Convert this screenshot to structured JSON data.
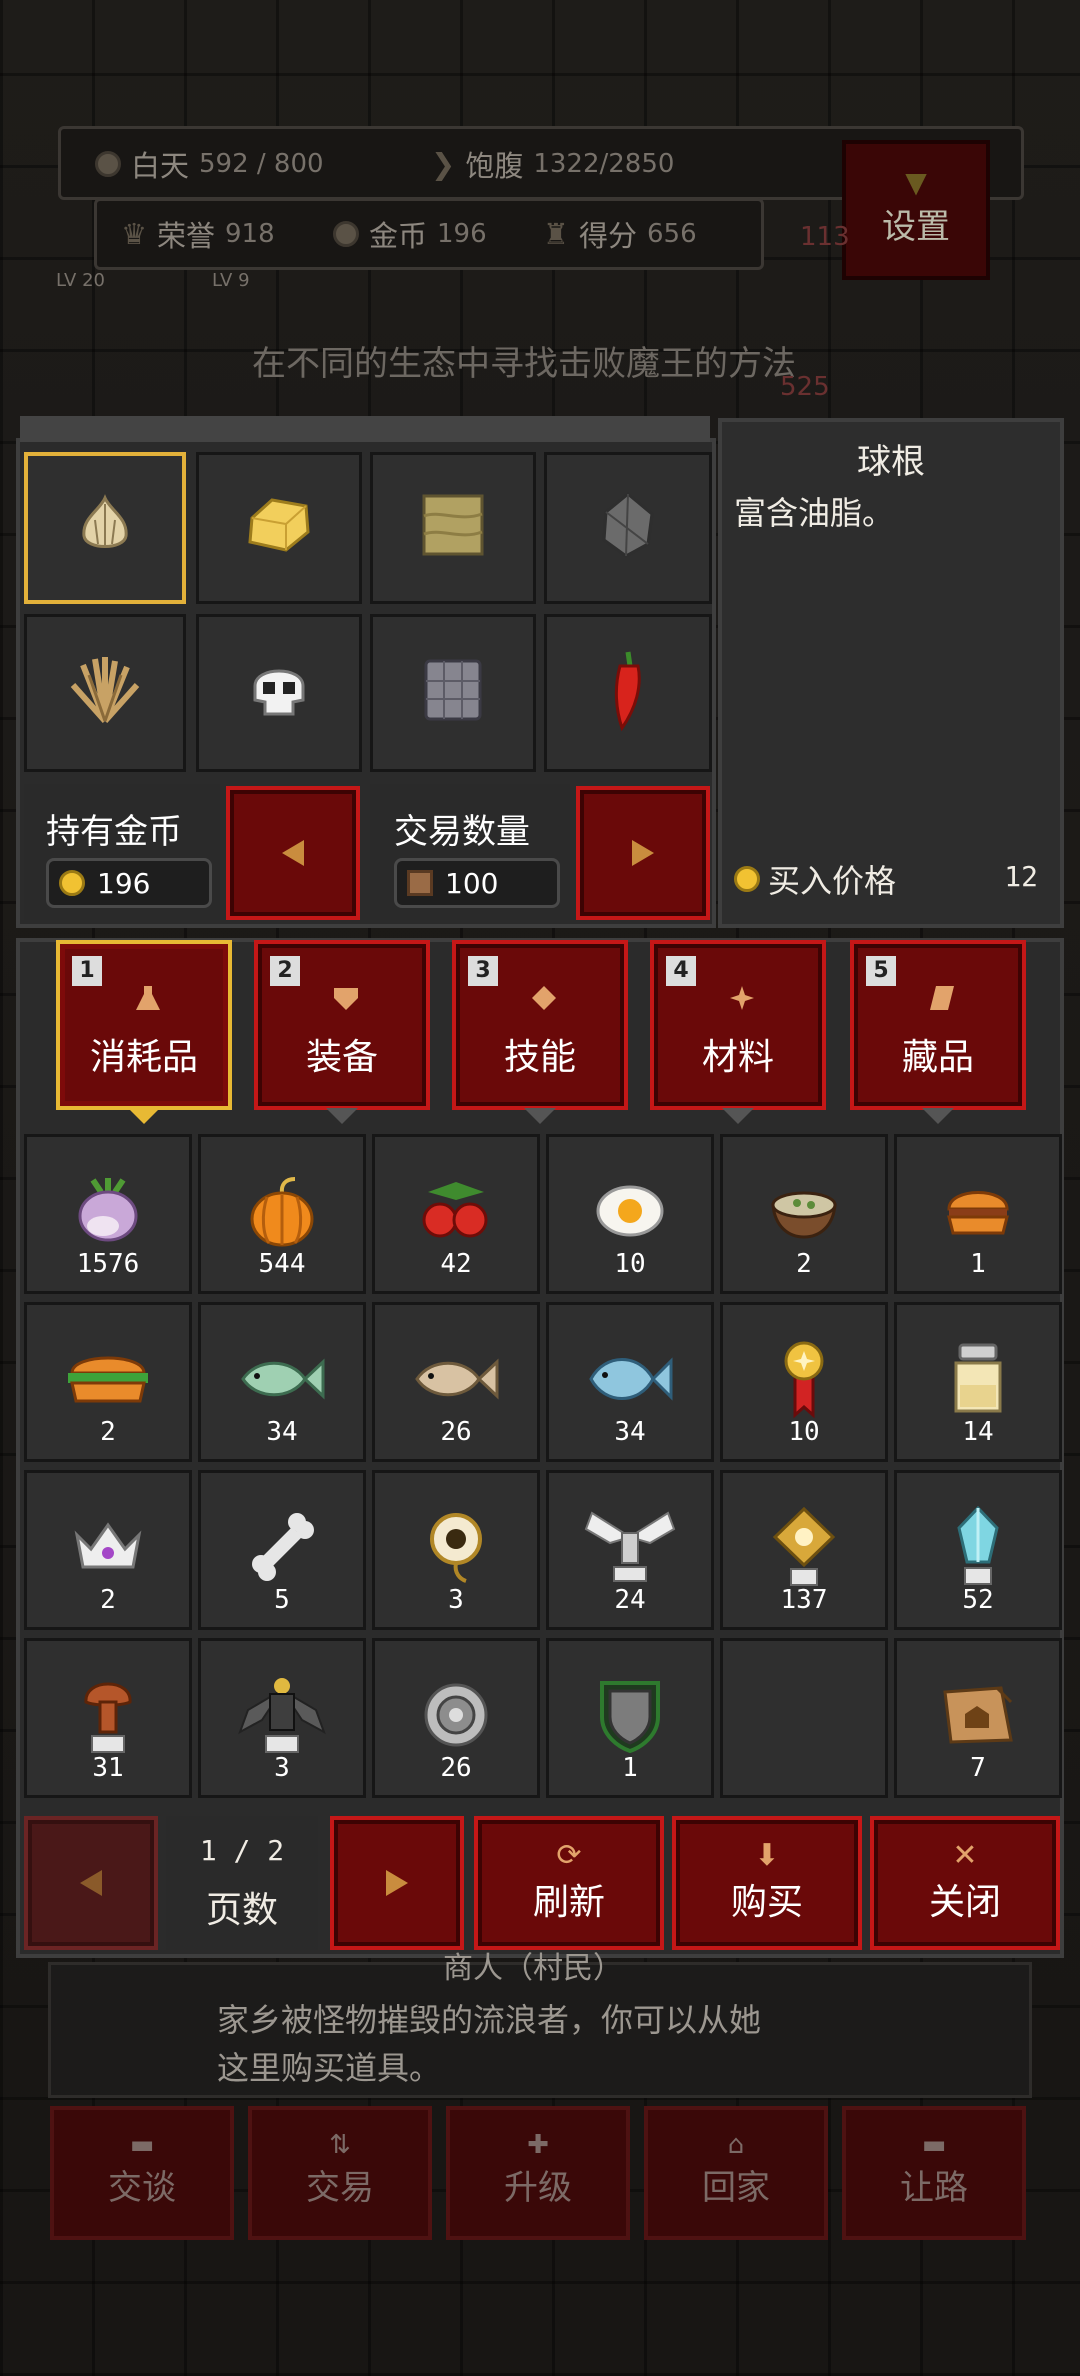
{
  "hud": {
    "day_label": "白天",
    "day_value": "592 / 800",
    "hunger_label": "饱腹",
    "hunger_value": "1322/2850",
    "honor_label": "荣誉",
    "honor_value": "918",
    "gold_label": "金币",
    "gold_value": "196",
    "score_label": "得分",
    "score_value": "656",
    "settings": "设置",
    "hint": "在不同的生态中寻找击败魔王的方法",
    "lv_left": "LV 20",
    "lv_mid": "LV 9",
    "hp_small": "525",
    "hp_small2": "113"
  },
  "detail": {
    "name": "球根",
    "desc": "富含油脂。",
    "price_label": "买入价格",
    "price_value": "12"
  },
  "wallet": {
    "gold_label": "持有金币",
    "gold_value": "196",
    "qty_label": "交易数量",
    "qty_value": "100"
  },
  "tabs": [
    {
      "num": "1",
      "label": "消耗品"
    },
    {
      "num": "2",
      "label": "装备"
    },
    {
      "num": "3",
      "label": "技能"
    },
    {
      "num": "4",
      "label": "材料"
    },
    {
      "num": "5",
      "label": "藏品"
    }
  ],
  "items": [
    {
      "count": "1576",
      "icon": "turnip-icon"
    },
    {
      "count": "544",
      "icon": "pumpkin-icon"
    },
    {
      "count": "42",
      "icon": "berries-icon"
    },
    {
      "count": "10",
      "icon": "fried-egg-icon"
    },
    {
      "count": "2",
      "icon": "soup-bowl-icon"
    },
    {
      "count": "1",
      "icon": "burger-icon"
    },
    {
      "count": "2",
      "icon": "sandwich-icon"
    },
    {
      "count": "34",
      "icon": "green-fish-icon"
    },
    {
      "count": "26",
      "icon": "brown-fish-icon"
    },
    {
      "count": "34",
      "icon": "blue-fish-icon"
    },
    {
      "count": "10",
      "icon": "medal-icon"
    },
    {
      "count": "14",
      "icon": "jar-icon"
    },
    {
      "count": "2",
      "icon": "crown-icon"
    },
    {
      "count": "5",
      "icon": "bone-icon"
    },
    {
      "count": "3",
      "icon": "eye-icon"
    },
    {
      "count": "24",
      "icon": "winged-relic-icon"
    },
    {
      "count": "137",
      "icon": "gold-relic-icon"
    },
    {
      "count": "52",
      "icon": "crystal-icon"
    },
    {
      "count": "31",
      "icon": "mushroom-statue-icon"
    },
    {
      "count": "3",
      "icon": "dark-idol-icon"
    },
    {
      "count": "26",
      "icon": "target-icon"
    },
    {
      "count": "1",
      "icon": "shield-icon"
    },
    {
      "count": "",
      "icon": "empty-slot"
    },
    {
      "count": "7",
      "icon": "treasure-map-icon"
    }
  ],
  "pager": {
    "page": "1 / 2",
    "page_label": "页数",
    "refresh": "刷新",
    "buy": "购买",
    "close": "关闭"
  },
  "npc": {
    "name": "商人（村民）",
    "line1": "家乡被怪物摧毁的流浪者，你可以从她",
    "line2": "这里购买道具。"
  },
  "actions": [
    {
      "label": "交谈"
    },
    {
      "label": "交易"
    },
    {
      "label": "升级"
    },
    {
      "label": "回家"
    },
    {
      "label": "让路"
    }
  ]
}
